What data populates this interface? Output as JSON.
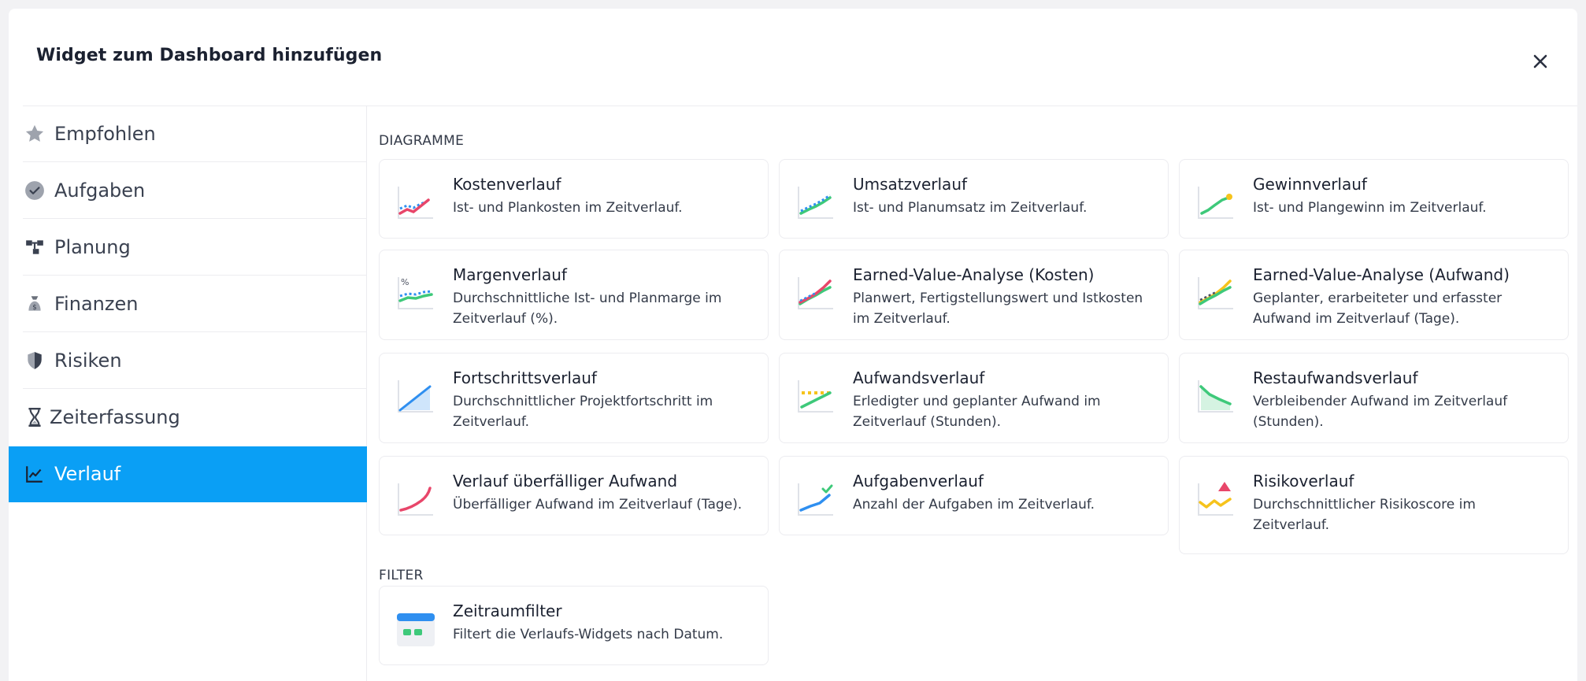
{
  "dialog": {
    "title": "Widget zum Dashboard hinzufügen",
    "close_icon": "close-icon"
  },
  "sidebar": {
    "items": [
      {
        "label": "Empfohlen",
        "icon": "star-icon"
      },
      {
        "label": "Aufgaben",
        "icon": "check-circle-icon"
      },
      {
        "label": "Planung",
        "icon": "hierarchy-icon"
      },
      {
        "label": "Finanzen",
        "icon": "money-bag-icon"
      },
      {
        "label": "Risiken",
        "icon": "shield-icon"
      },
      {
        "label": "Zeiterfassung",
        "icon": "hourglass-icon"
      },
      {
        "label": "Verlauf",
        "icon": "line-chart-icon",
        "active": true
      }
    ]
  },
  "sections": {
    "charts": {
      "label": "DIAGRAMME",
      "cards": [
        {
          "title": "Kostenverlauf",
          "desc": "Ist- und Plankosten im Zeitverlauf.",
          "icon": "cost-trend-icon"
        },
        {
          "title": "Umsatzverlauf",
          "desc": "Ist- und Planumsatz im Zeitverlauf.",
          "icon": "revenue-trend-icon"
        },
        {
          "title": "Gewinnverlauf",
          "desc": "Ist- und Plangewinn im Zeitverlauf.",
          "icon": "profit-trend-icon"
        },
        {
          "title": "Margenverlauf",
          "desc": "Durchschnittliche Ist- und Planmarge im Zeitverlauf (%).",
          "icon": "margin-trend-icon"
        },
        {
          "title": "Earned-Value-Analyse (Kosten)",
          "desc": "Planwert, Fertigstellungswert und Istkosten im Zeitverlauf.",
          "icon": "earned-value-cost-icon"
        },
        {
          "title": "Earned-Value-Analyse (Aufwand)",
          "desc": "Geplanter, erarbeiteter und erfasster Aufwand im Zeitverlauf (Tage).",
          "icon": "earned-value-effort-icon"
        },
        {
          "title": "Fortschrittsverlauf",
          "desc": "Durchschnittlicher Projektfortschritt im Zeitverlauf.",
          "icon": "progress-trend-icon"
        },
        {
          "title": "Aufwandsverlauf",
          "desc": "Erledigter und geplanter Aufwand im Zeitverlauf (Stunden).",
          "icon": "effort-trend-icon"
        },
        {
          "title": "Restaufwandsverlauf",
          "desc": "Verbleibender Aufwand im Zeitverlauf (Stunden).",
          "icon": "remaining-effort-icon"
        },
        {
          "title": "Verlauf überfälliger Aufwand",
          "desc": "Überfälliger Aufwand im Zeitverlauf (Tage).",
          "icon": "overdue-effort-icon"
        },
        {
          "title": "Aufgabenverlauf",
          "desc": "Anzahl der Aufgaben im Zeitverlauf.",
          "icon": "task-trend-icon"
        },
        {
          "title": "Risikoverlauf",
          "desc": "Durchschnittlicher Risikoscore im Zeitverlauf.",
          "icon": "risk-trend-icon"
        }
      ]
    },
    "filter": {
      "label": "FILTER",
      "cards": [
        {
          "title": "Zeitraumfilter",
          "desc": "Filtert die Verlaufs-Widgets nach Datum.",
          "icon": "date-range-filter-icon"
        }
      ]
    }
  },
  "colors": {
    "accent": "#0a9ff5",
    "red": "#e8466a",
    "green": "#3ec97a",
    "blue": "#2f8ff0",
    "yellow": "#f6c31c"
  }
}
